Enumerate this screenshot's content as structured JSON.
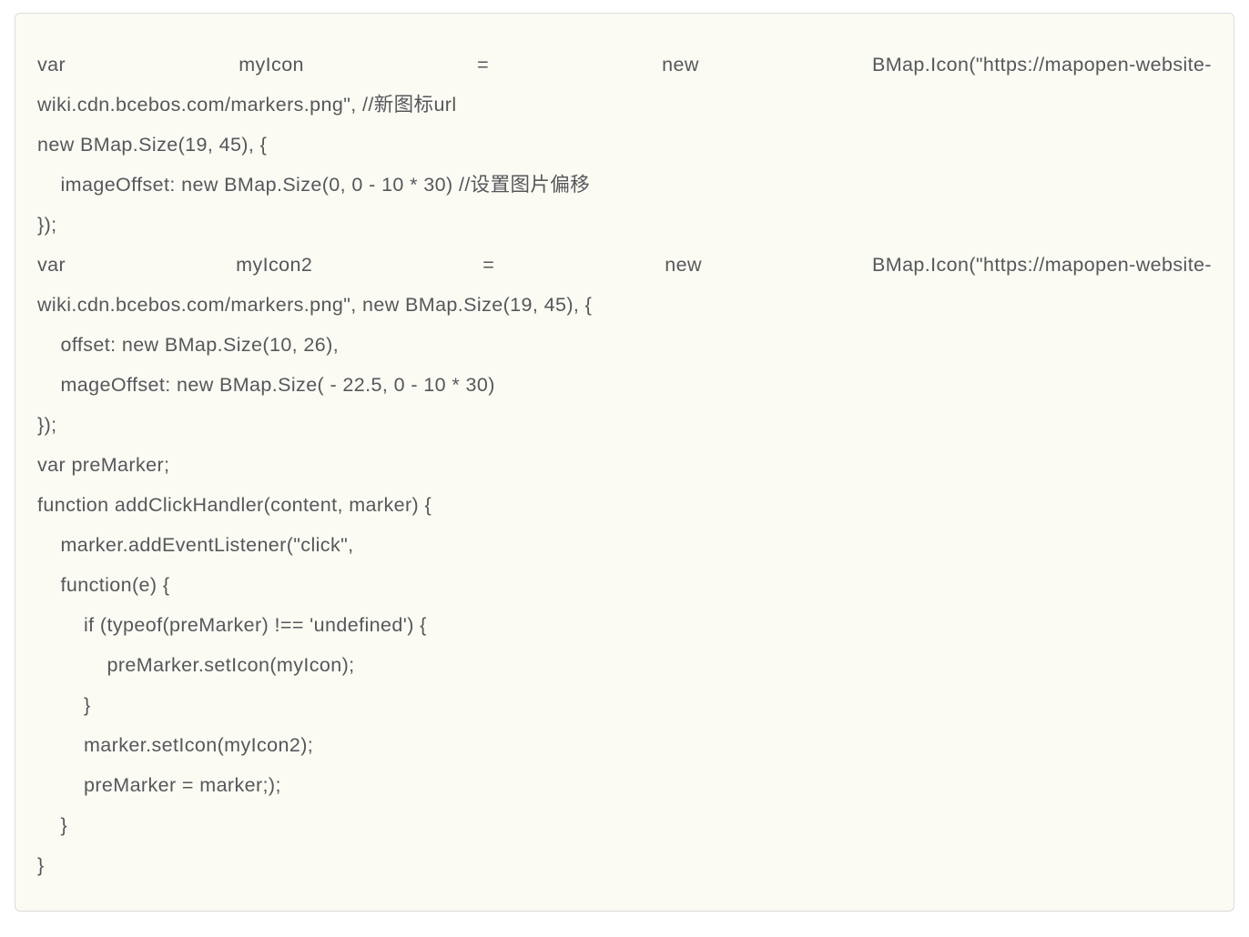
{
  "code": {
    "lines": [
      {
        "justified": true,
        "segments": [
          "var",
          "myIcon",
          "=",
          "new",
          "BMap.Icon(\"https://mapopen-website-"
        ]
      },
      {
        "text": "wiki.cdn.bcebos.com/markers.png\", //新图标url"
      },
      {
        "text": "new BMap.Size(19, 45), {"
      },
      {
        "text": "    imageOffset: new BMap.Size(0, 0 - 10 * 30) //设置图片偏移"
      },
      {
        "text": "});"
      },
      {
        "justified": true,
        "segments": [
          "var",
          "myIcon2",
          "=",
          "new",
          "BMap.Icon(\"https://mapopen-website-"
        ]
      },
      {
        "text": "wiki.cdn.bcebos.com/markers.png\", new BMap.Size(19, 45), {"
      },
      {
        "text": "    offset: new BMap.Size(10, 26),"
      },
      {
        "text": "    mageOffset: new BMap.Size( - 22.5, 0 - 10 * 30)"
      },
      {
        "text": "});"
      },
      {
        "text": "var preMarker;"
      },
      {
        "text": "function addClickHandler(content, marker) {"
      },
      {
        "text": "    marker.addEventListener(\"click\","
      },
      {
        "text": "    function(e) {"
      },
      {
        "text": "        if (typeof(preMarker) !== 'undefined') {"
      },
      {
        "text": "            preMarker.setIcon(myIcon);"
      },
      {
        "text": "        }"
      },
      {
        "text": "        marker.setIcon(myIcon2);"
      },
      {
        "text": "        preMarker = marker;);"
      },
      {
        "text": "    }"
      },
      {
        "text": "}"
      }
    ]
  }
}
